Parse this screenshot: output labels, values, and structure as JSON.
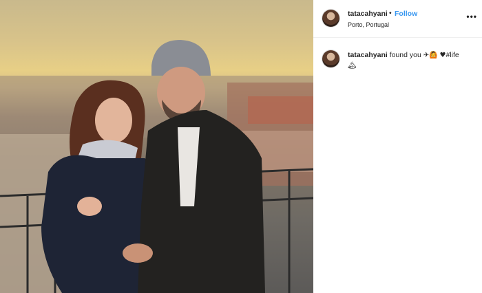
{
  "post": {
    "username": "tatacahyani",
    "follow_label": "Follow",
    "separator": "•",
    "location": "Porto, Portugal",
    "more_icon": "more-options-icon",
    "more_glyph": "•••"
  },
  "caption": {
    "username": "tatacahyani",
    "text": "found you",
    "emoji_1": "✈",
    "emoji_2": "🙆",
    "heart": "♥",
    "hashtag": "#life",
    "emoji_3": "🏔"
  },
  "colors": {
    "follow": "#3897f0",
    "text": "#262626",
    "divider": "#efefef"
  }
}
